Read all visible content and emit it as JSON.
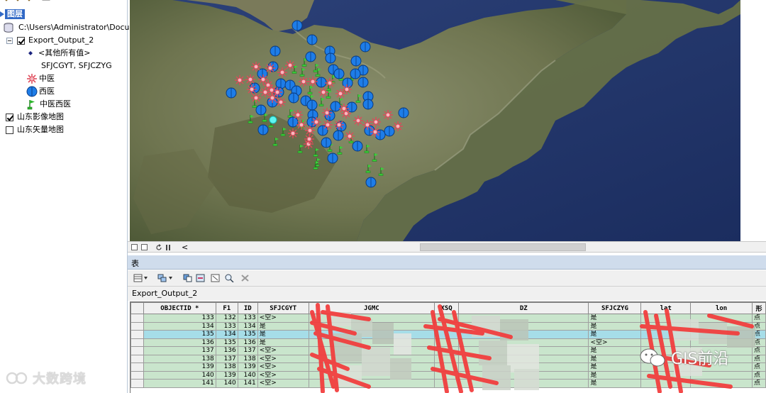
{
  "toc": {
    "title": "图层",
    "path": "C:\\Users\\Administrator\\Docu",
    "layer_export": "Export_Output_2",
    "other_values": "<其他所有值>",
    "fields": "SFJCGYT, SFJCZYG",
    "legend": [
      {
        "label": "中医",
        "icon": "tcm-asterisk-icon",
        "color": "#e05060"
      },
      {
        "label": "西医",
        "icon": "western-circle-icon",
        "color": "#1e7de8"
      },
      {
        "label": "中医西医",
        "icon": "combined-flag-icon",
        "color": "#2db52d"
      }
    ],
    "layer_imagery": "山东影像地图",
    "layer_vector": "山东矢量地图",
    "imagery_checked": true,
    "vector_checked": false,
    "export_checked": true
  },
  "table_window": {
    "title": "表",
    "tab_name": "Export_Output_2",
    "close_symbol": "✕",
    "columns": [
      "OBJECTID *",
      "F1",
      "ID",
      "SFJCGYT",
      "JGMC",
      "XSQ",
      "DZ",
      "SFJCZYG",
      "lat",
      "lon",
      "形"
    ],
    "rows": [
      {
        "objectid": "133",
        "f1": "132",
        "id": "133",
        "sfjcgyt": "<空>",
        "sfjczyg": "是",
        "xing": "点",
        "highlight": false
      },
      {
        "objectid": "134",
        "f1": "133",
        "id": "134",
        "sfjcgyt": "是",
        "sfjczyg": "是",
        "xing": "点",
        "highlight": false
      },
      {
        "objectid": "135",
        "f1": "134",
        "id": "135",
        "sfjcgyt": "是",
        "sfjczyg": "是",
        "xing": "点",
        "highlight": true
      },
      {
        "objectid": "136",
        "f1": "135",
        "id": "136",
        "sfjcgyt": "是",
        "sfjczyg": "<空>",
        "xing": "点",
        "highlight": false
      },
      {
        "objectid": "137",
        "f1": "136",
        "id": "137",
        "sfjcgyt": "<空>",
        "sfjczyg": "是",
        "xing": "点",
        "highlight": false
      },
      {
        "objectid": "138",
        "f1": "137",
        "id": "138",
        "sfjcgyt": "<空>",
        "sfjczyg": "是",
        "xing": "点",
        "highlight": false
      },
      {
        "objectid": "139",
        "f1": "138",
        "id": "139",
        "sfjcgyt": "<空>",
        "sfjczyg": "是",
        "xing": "点",
        "highlight": false
      },
      {
        "objectid": "140",
        "f1": "139",
        "id": "140",
        "sfjcgyt": "<空>",
        "sfjczyg": "是",
        "xing": "点",
        "highlight": false
      },
      {
        "objectid": "141",
        "f1": "140",
        "id": "141",
        "sfjcgyt": "<空>",
        "sfjczyg": "是",
        "xing": "点",
        "highlight": false
      }
    ]
  },
  "mapbar": {
    "back_label": "<"
  },
  "watermarks": {
    "left": "大数跨境",
    "right": "GIS前沿"
  },
  "colors": {
    "row_green": "#c9e5cc",
    "row_highlight": "#a6dde8",
    "table_title_bg": "#cfdcec",
    "toc_selected": "#3169c6"
  }
}
